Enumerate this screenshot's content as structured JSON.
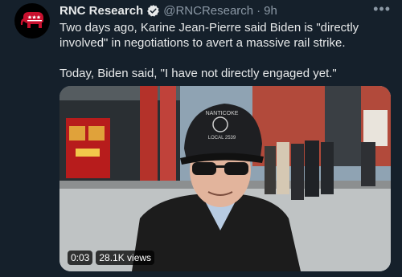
{
  "account": {
    "name": "RNC Research",
    "handle": "@RNCResearch",
    "time": "9h"
  },
  "tweet": {
    "paragraph1": "Two days ago, Karine Jean-Pierre said Biden is \"directly involved\" in negotiations to avert a massive rail strike.",
    "paragraph2": "Today, Biden said, \"I have not directly engaged yet.\""
  },
  "video": {
    "duration": "0:03",
    "views": "28.1K views",
    "cap_text_top": "NANTICOKE",
    "cap_text_bottom": "LOCAL 2539"
  },
  "icons": {
    "avatar": "gop-elephant-logo",
    "verified": "verified-badge-icon",
    "more": "more-icon"
  },
  "colors": {
    "background": "#15202b",
    "avatar_red": "#c8102e",
    "verified_blue": "#1d9bf0"
  }
}
